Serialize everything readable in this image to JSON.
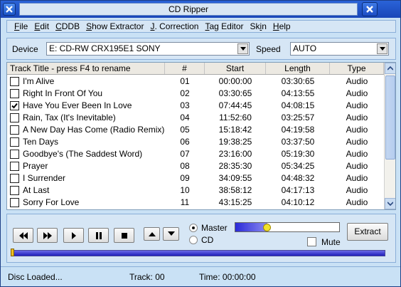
{
  "window": {
    "title": "CD Ripper"
  },
  "menu": [
    "File",
    "Edit",
    "CDDB",
    "Show Extractor",
    "J. Correction",
    "Tag Editor",
    "Skin",
    "Help"
  ],
  "device": {
    "label": "Device",
    "value": "E: CD-RW  CRX195E1  SONY",
    "speed_label": "Speed",
    "speed_value": "AUTO"
  },
  "tracks": {
    "headers": {
      "title": "Track Title - press F4 to rename",
      "num": "#",
      "start": "Start",
      "length": "Length",
      "type": "Type"
    },
    "rows": [
      {
        "checked": false,
        "title": "I'm Alive",
        "num": "01",
        "start": "00:00:00",
        "length": "03:30:65",
        "type": "Audio"
      },
      {
        "checked": false,
        "title": "Right In Front Of You",
        "num": "02",
        "start": "03:30:65",
        "length": "04:13:55",
        "type": "Audio"
      },
      {
        "checked": true,
        "title": "Have You Ever Been In Love",
        "num": "03",
        "start": "07:44:45",
        "length": "04:08:15",
        "type": "Audio"
      },
      {
        "checked": false,
        "title": "Rain, Tax (It's Inevitable)",
        "num": "04",
        "start": "11:52:60",
        "length": "03:25:57",
        "type": "Audio"
      },
      {
        "checked": false,
        "title": "A New Day Has Come (Radio Remix)",
        "num": "05",
        "start": "15:18:42",
        "length": "04:19:58",
        "type": "Audio"
      },
      {
        "checked": false,
        "title": "Ten Days",
        "num": "06",
        "start": "19:38:25",
        "length": "03:37:50",
        "type": "Audio"
      },
      {
        "checked": false,
        "title": "Goodbye's (The Saddest Word)",
        "num": "07",
        "start": "23:16:00",
        "length": "05:19:30",
        "type": "Audio"
      },
      {
        "checked": false,
        "title": "Prayer",
        "num": "08",
        "start": "28:35:30",
        "length": "05:34:25",
        "type": "Audio"
      },
      {
        "checked": false,
        "title": "I Surrender",
        "num": "09",
        "start": "34:09:55",
        "length": "04:48:32",
        "type": "Audio"
      },
      {
        "checked": false,
        "title": "At Last",
        "num": "10",
        "start": "38:58:12",
        "length": "04:17:13",
        "type": "Audio"
      },
      {
        "checked": false,
        "title": "Sorry For Love",
        "num": "11",
        "start": "43:15:25",
        "length": "04:10:12",
        "type": "Audio"
      }
    ]
  },
  "controls": {
    "master_label": "Master",
    "cd_label": "CD",
    "selected_source": "Master",
    "volume_text": "31 %",
    "volume_fraction": 0.31,
    "mute_label": "Mute",
    "mute_checked": false,
    "extract_label": "Extract",
    "playback_progress": 0.0,
    "icons": [
      "rewind-icon",
      "fast-forward-icon",
      "play-icon",
      "pause-icon",
      "stop-icon",
      "eject-icon",
      "next-disc-icon"
    ]
  },
  "status": {
    "message": "Disc Loaded...",
    "track": "Track: 00",
    "time": "Time: 00:00:00"
  },
  "colors": {
    "titlebar": "#1f4fc4",
    "panel": "#d6e6f5",
    "volume": "#2a2ad8",
    "progress": "#1d1dba"
  }
}
